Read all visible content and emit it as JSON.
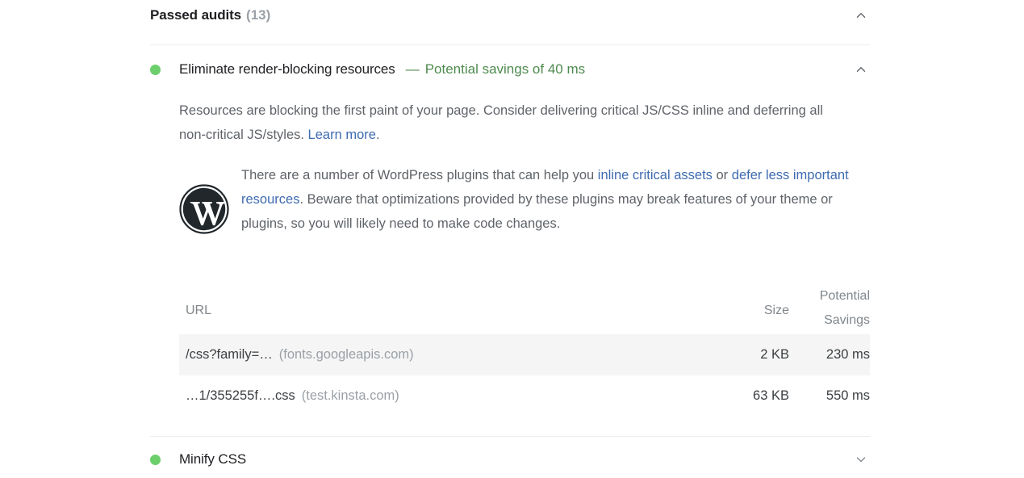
{
  "section": {
    "title": "Passed audits",
    "count": "(13)",
    "chevron_icon": "chevron-up-icon"
  },
  "audit": {
    "status_icon": "green-circle-icon",
    "status_color": "#6ccf6c",
    "title": "Eliminate render-blocking resources",
    "separator": "—",
    "savings_label": "Potential savings of 40 ms",
    "savings_color": "#4f8a4f",
    "chevron_icon": "chevron-up-icon",
    "description": {
      "part1": "Resources are blocking the first paint of your page. Consider delivering critical JS/CSS inline and deferring all non-critical JS/styles. ",
      "link": "Learn more",
      "part2": "."
    },
    "plugin_note": {
      "logo_icon": "wordpress-logo-icon",
      "part1": "There are a number of WordPress plugins that can help you ",
      "link1": "inline critical assets",
      "part2": " or ",
      "link2": "defer less important resources",
      "part3": ". Beware that optimizations provided by these plugins may break features of your theme or plugins, so you will likely need to make code changes."
    },
    "table": {
      "columns": {
        "url": "URL",
        "size": "Size",
        "savings_line1": "Potential",
        "savings_line2": "Savings"
      },
      "rows": [
        {
          "url": "/css?family=…",
          "host": "(fonts.googleapis.com)",
          "size": "2 KB",
          "savings": "230 ms",
          "shaded": true
        },
        {
          "url": "…1/355255f….css",
          "host": "(test.kinsta.com)",
          "size": "63 KB",
          "savings": "550 ms",
          "shaded": false
        }
      ]
    }
  },
  "audit_bottom": {
    "status_icon": "green-circle-icon",
    "title": "Minify CSS",
    "chevron_icon": "chevron-down-icon"
  },
  "colors": {
    "link": "#3f6bb0",
    "muted": "#9aa0a6",
    "text": "#3c4043",
    "divider": "#eceff1",
    "row_shade": "#f5f5f5"
  }
}
